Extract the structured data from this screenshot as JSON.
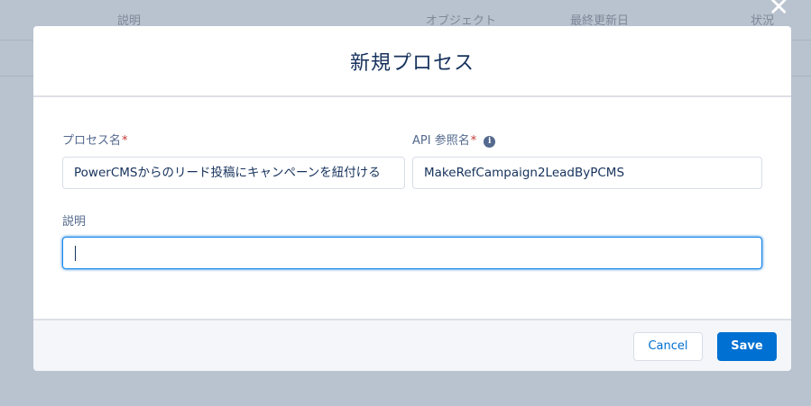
{
  "background": {
    "columns": [
      "説明",
      "オブジェクト",
      "最終更新日",
      "状況"
    ]
  },
  "modal": {
    "title": "新規プロセス",
    "close_icon": "close-icon",
    "fields": {
      "process_name": {
        "label": "プロセス名",
        "required_mark": "*",
        "value": "PowerCMSからのリード投稿にキャンペーンを紐付ける"
      },
      "api_name": {
        "label": "API 参照名",
        "required_mark": "*",
        "info_icon": "info-icon",
        "value": "MakeRefCampaign2LeadByPCMS"
      },
      "description": {
        "label": "説明",
        "value": ""
      }
    },
    "footer": {
      "cancel_label": "Cancel",
      "save_label": "Save"
    }
  },
  "colors": {
    "overlay": "#b9c3cf",
    "title": "#16325c",
    "label": "#54698d",
    "required": "#c23934",
    "brand": "#0070d2",
    "focus": "#1589ee"
  }
}
